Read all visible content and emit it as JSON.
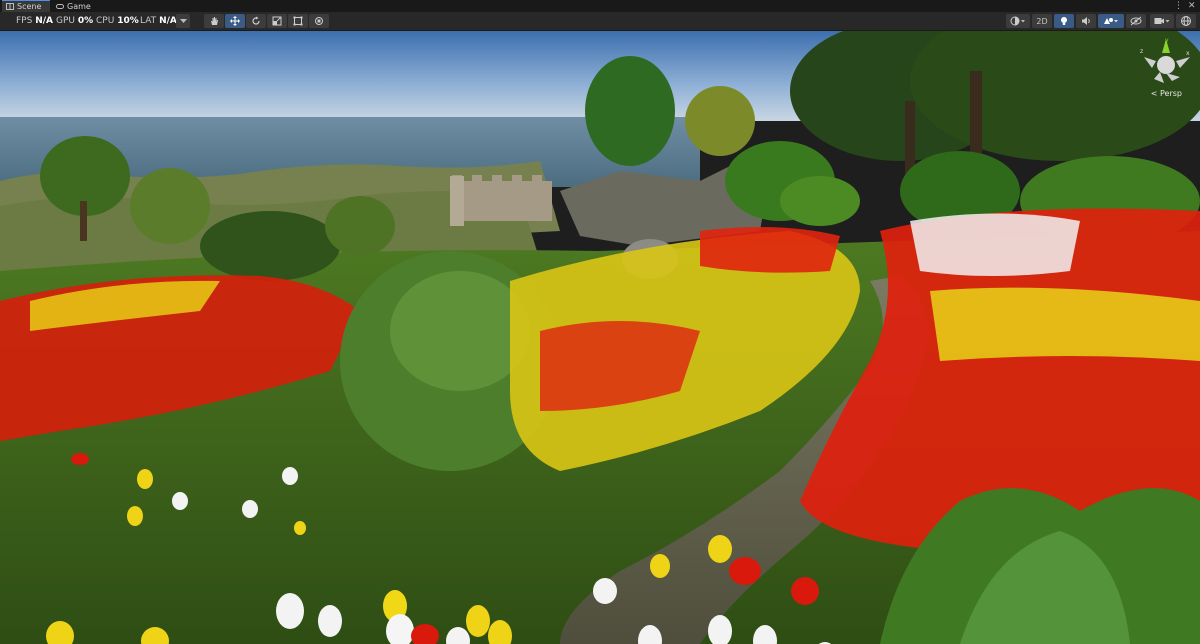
{
  "tabs": [
    {
      "label": "Scene",
      "icon": "scene-grid-icon",
      "active": true
    },
    {
      "label": "Game",
      "icon": "game-controller-icon",
      "active": false
    }
  ],
  "stats": {
    "fps_label": "FPS",
    "fps_value": "N/A",
    "gpu_label": "GPU",
    "gpu_value": "0%",
    "cpu_label": "CPU",
    "cpu_value": "10%",
    "lat_label": "LAT",
    "lat_value": "N/A"
  },
  "toolbar": {
    "tools": [
      "hand-tool-icon",
      "move-tool-icon",
      "rotate-tool-icon",
      "scale-tool-icon",
      "rect-tool-icon",
      "transform-tool-icon"
    ],
    "selected_tool": "move-tool-icon",
    "mode_2d_label": "2D",
    "right_icons": [
      "shading-mode-icon",
      "lighting-toggle-icon",
      "audio-toggle-icon",
      "effects-icon",
      "visibility-icon",
      "camera-icon",
      "gizmos-icon"
    ]
  },
  "viewport": {
    "camera_label": "< Persp",
    "gizmo_axes": [
      "y",
      "z",
      "x"
    ]
  },
  "colors": {
    "accent": "#4d90e6",
    "sky_top": "#5f8fc4",
    "sea": "#5d7f95",
    "grass": "#3f6a1c",
    "flower_red": "#e61e0a",
    "flower_yellow": "#f0dc14",
    "flower_white": "#f5f5f5"
  }
}
